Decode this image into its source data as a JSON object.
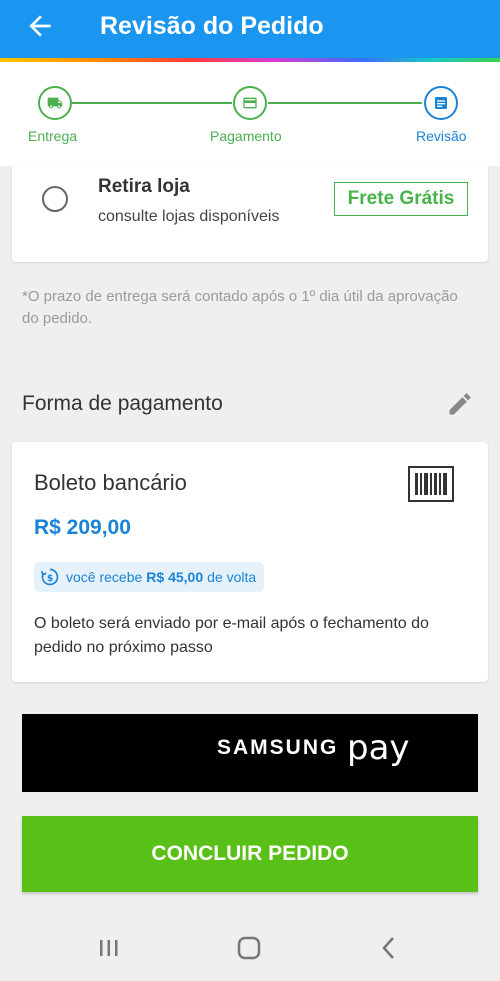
{
  "header": {
    "title": "Revisão do Pedido"
  },
  "steps": [
    {
      "label": "Entrega"
    },
    {
      "label": "Pagamento"
    },
    {
      "label": "Revisão"
    }
  ],
  "delivery_option": {
    "title": "Retira loja",
    "subtitle": "consulte lojas disponíveis",
    "badge": "Frete Grátis"
  },
  "delivery_note": "*O prazo de entrega será contado após o 1º dia útil da aprovação do pedido.",
  "payment": {
    "section_title": "Forma de pagamento",
    "method": "Boleto bancário",
    "price": "R$ 209,00",
    "cashback_prefix": "você recebe",
    "cashback_amount": "R$ 45,00",
    "cashback_suffix": "de volta",
    "info": "O boleto será enviado por e-mail após o fechamento do pedido no próximo passo"
  },
  "samsung_pay": {
    "brand": "SAMSUNG",
    "pay": "pay"
  },
  "confirm_button": "CONCLUIR PEDIDO",
  "colors": {
    "primary": "#1a96f0",
    "step_done": "#4caf50",
    "step_current": "#1a83d8",
    "confirm": "#59c018"
  }
}
